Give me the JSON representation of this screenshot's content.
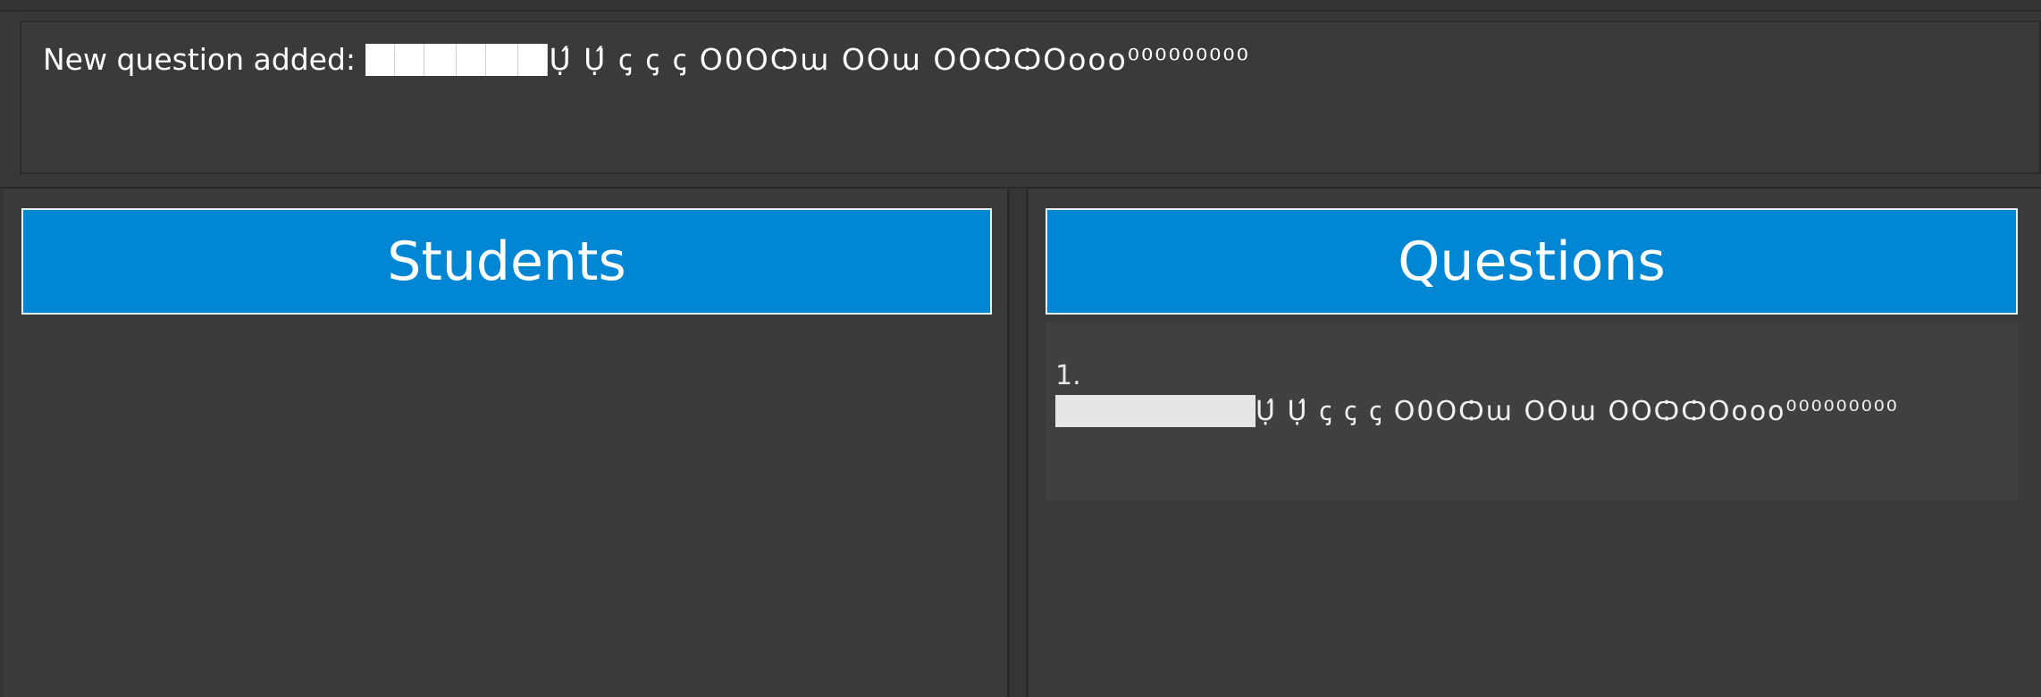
{
  "result_display": {
    "prefix": "New question added:",
    "suffix": "Ụ́ Ụ́ ꞔ ꞔ ꞔ O0OѺա OOա OOѺѺOooo⁰⁰⁰⁰⁰⁰⁰⁰⁰"
  },
  "students_panel": {
    "title": "Students"
  },
  "questions_panel": {
    "title": "Questions",
    "items": [
      {
        "index": "1.",
        "text": "Ụ́ Ụ́ ꞔ ꞔ ꞔ O0OѺա OOա OOѺѺOooo⁰⁰⁰⁰⁰⁰⁰⁰⁰"
      }
    ]
  },
  "colors": {
    "header_blue": "#0086d3",
    "background": "#3b3b3b"
  }
}
